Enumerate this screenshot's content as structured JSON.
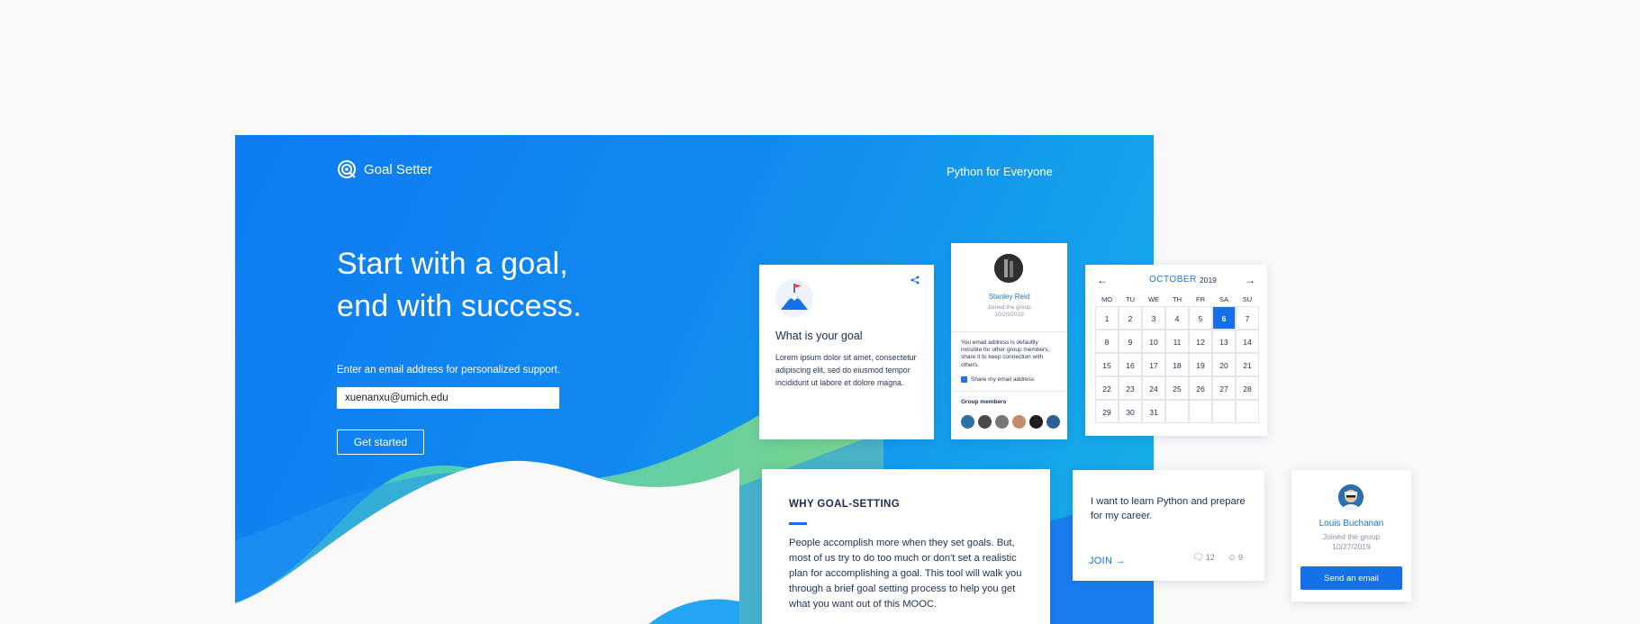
{
  "brand": {
    "name": "Goal Setter",
    "logo_icon": "target-icon"
  },
  "nav": {
    "course_link": "Python for Everyone"
  },
  "hero": {
    "headline_line1": "Start with a goal,",
    "headline_line2": "end with success.",
    "prompt": "Enter an email address for personalized support.",
    "email_value": "xuenanxu@umich.edu",
    "cta_label": "Get started"
  },
  "goal_card": {
    "icon": "mountain-flag-icon",
    "title": "What is your goal",
    "body": "Lorem ipsum dolor sit amet, consectetur adipiscing elit, sed do eiusmod tempor incididunt ut labore et dolore magna."
  },
  "member_card": {
    "name": "Stanley Reid",
    "joined_label": "Joined the group",
    "joined_date": "10/20/2019",
    "note": "You email address is defaultly invisible for other group members, share it to keep connection with others.",
    "share_label": "Share my email address",
    "group_members_label": "Group members"
  },
  "calendar": {
    "month": "OCTOBER",
    "year": "2019",
    "weekdays": [
      "MO",
      "TU",
      "WE",
      "TH",
      "FR",
      "SA",
      "SU"
    ],
    "days": [
      "1",
      "2",
      "3",
      "4",
      "5",
      "6",
      "7",
      "8",
      "9",
      "10",
      "11",
      "12",
      "13",
      "14",
      "15",
      "16",
      "17",
      "18",
      "19",
      "20",
      "21",
      "22",
      "23",
      "24",
      "25",
      "26",
      "27",
      "28",
      "29",
      "30",
      "31",
      "",
      "",
      "",
      ""
    ],
    "selected_day": "6"
  },
  "why_card": {
    "title": "WHY GOAL-SETTING",
    "body": "People accomplish more when they set goals. But, most of us try to do too much or don't set a realistic plan for accomplishing a goal. This tool will walk you through a brief goal setting process to help you get what you want out of this MOOC."
  },
  "learn_card": {
    "text": "I want to learn Python and prepare for my career.",
    "join_label": "JOIN",
    "comments": "12",
    "members": "9"
  },
  "louis_card": {
    "name": "Louis Buchanan",
    "joined_label": "Joined the group",
    "joined_date": "10/27/2019",
    "button_label": "Send an email"
  },
  "colors": {
    "primary": "#1670ea",
    "hero_start": "#0f7cf2",
    "hero_end": "#17b1e8",
    "wave_green": "#5fd1a5",
    "text_dark": "#1d2b4f"
  }
}
